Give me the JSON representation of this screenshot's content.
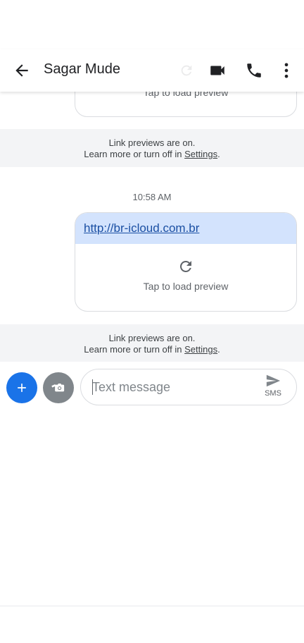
{
  "header": {
    "title": "Sagar Mude",
    "back_icon": "arrow-back-icon",
    "actions": [
      "video-call-icon",
      "phone-icon",
      "more-vert-icon"
    ]
  },
  "messages": {
    "previous_card": {
      "tap_label": "Tap to load preview"
    },
    "notice_1": {
      "line1": "Link previews are on.",
      "line2_prefix": "Learn more or turn off in ",
      "settings_link": "Settings",
      "suffix": "."
    },
    "timestamp": "10:58 AM",
    "link_card": {
      "url": "http://br-icloud.com.br",
      "tap_label": "Tap to load preview"
    },
    "notice_2": {
      "line1": "Link previews are on.",
      "line2_prefix": "Learn more or turn off in ",
      "settings_link": "Settings",
      "suffix": "."
    }
  },
  "compose": {
    "placeholder": "Text message",
    "send_label": "SMS"
  },
  "colors": {
    "accent": "#1a73e8",
    "link_strip": "#d3e3fd",
    "notice_bg": "#f3f4f6"
  }
}
